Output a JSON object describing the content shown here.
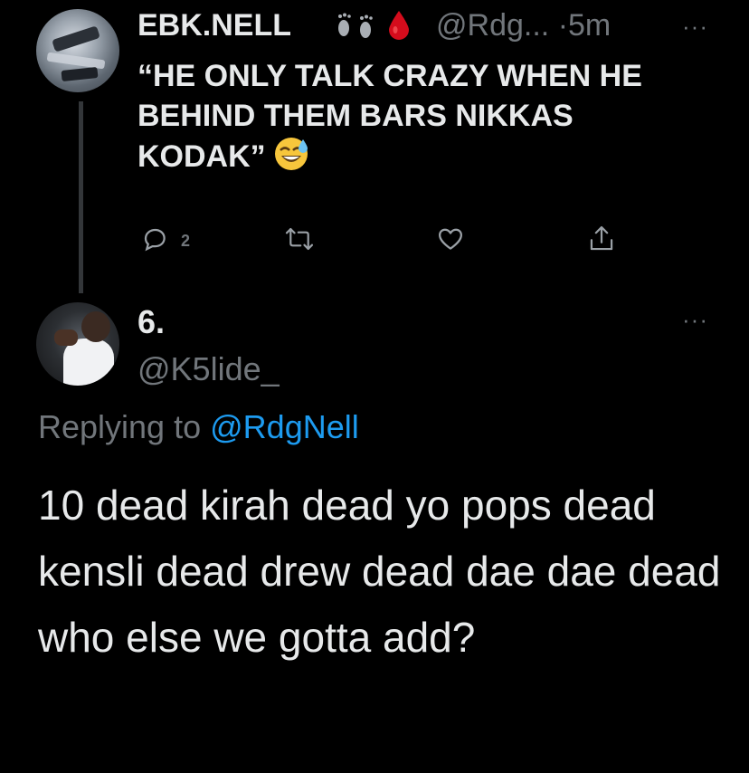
{
  "tweet1": {
    "display_name": "EBK.NELL",
    "handle": "@Rdg...",
    "time": "5m",
    "more": "···",
    "text": "“HE ONLY TALK CRAZY WHEN HE BEHIND THEM BARS NIKKAS KODAK”",
    "reply_count": "2",
    "icons": {
      "name_emojis": [
        "footprints-icon",
        "blood-drop-icon"
      ],
      "text_emoji": "sweat-smile-emoji",
      "actions": [
        "reply-icon",
        "retweet-icon",
        "like-icon",
        "share-icon"
      ]
    }
  },
  "tweet2": {
    "display_name": "6.",
    "handle": "@K5lide_",
    "more": "···",
    "replying_prefix": "Replying to",
    "replying_mention": "@RdgNell",
    "text": "10 dead kirah dead yo pops dead kensli dead drew dead dae dae dead who else we gotta add?"
  },
  "colors": {
    "background": "#000000",
    "text_primary": "#e7e9ea",
    "text_secondary": "#71767b",
    "accent": "#1d9bf0",
    "thread_line": "#333639",
    "blood": "#d40c1c"
  }
}
